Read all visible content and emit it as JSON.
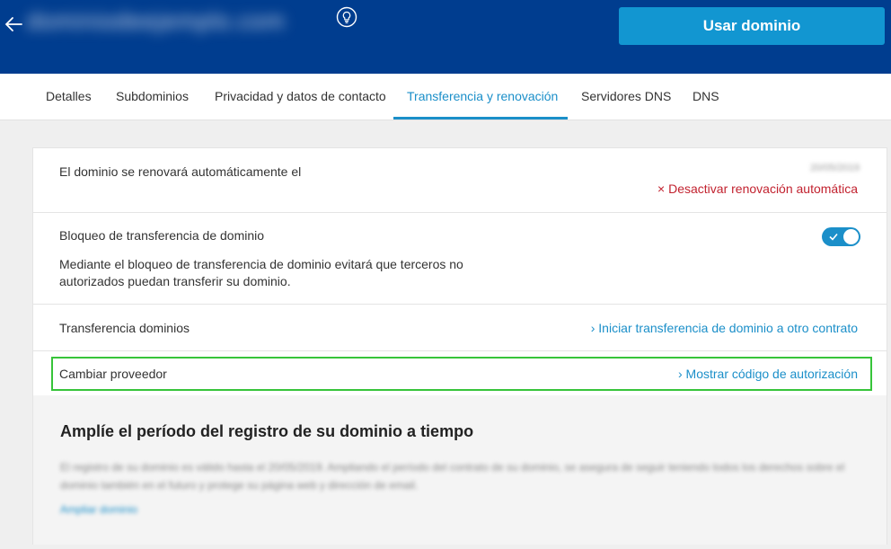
{
  "header": {
    "domain_name": "dominiodeejemplo.com",
    "use_domain_button": "Usar dominio"
  },
  "tabs": [
    {
      "label": "Detalles"
    },
    {
      "label": "Subdominios"
    },
    {
      "label": "Privacidad y datos de contacto"
    },
    {
      "label": "Transferencia y renovación",
      "active": true
    },
    {
      "label": "Servidores DNS"
    },
    {
      "label": "DNS"
    }
  ],
  "renewal": {
    "label": "El dominio se renovará automáticamente el",
    "date": "20/05/2019",
    "deactivate_link": "× Desactivar renovación automática"
  },
  "transfer_lock": {
    "label": "Bloqueo de transferencia de dominio",
    "description": "Mediante el bloqueo de transferencia de dominio evitará que terceros no autorizados puedan transferir su dominio.",
    "enabled": true
  },
  "transfer": {
    "label": "Transferencia dominios",
    "link": "› Iniciar transferencia de dominio a otro contrato"
  },
  "provider": {
    "label": "Cambiar proveedor",
    "link": "› Mostrar código de autorización"
  },
  "promo": {
    "title": "Amplíe el período del registro de su dominio a tiempo",
    "text": "El registro de su dominio es válido hasta el 20/05/2019. Ampliando el período del contrato de su dominio, se asegura de seguir teniendo todos los derechos sobre el dominio también en el futuro y protege su página web y dirección de email.",
    "link": "Ampliar dominio"
  },
  "colors": {
    "header_bg": "#003d8f",
    "primary": "#1296d1",
    "link": "#1b8fc9",
    "danger": "#c2222f",
    "highlight": "#37c43a"
  }
}
